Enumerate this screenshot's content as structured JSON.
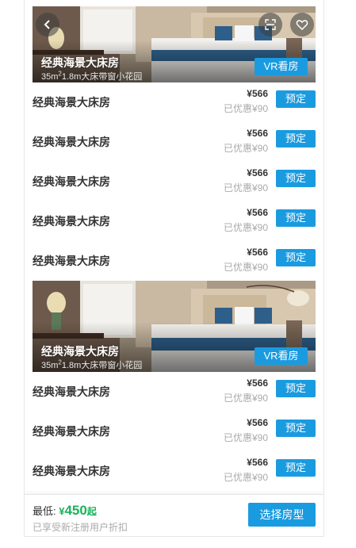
{
  "rooms": [
    {
      "title": "经典海景大床房",
      "size": "35m",
      "size_sup": "2",
      "desc": "1.8m大床带窗小花园",
      "vr_label": "VR看房",
      "options": [
        {
          "name": "经典海景大床房",
          "price": "¥566",
          "discount": "已优惠¥90",
          "book_label": "预定"
        },
        {
          "name": "经典海景大床房",
          "price": "¥566",
          "discount": "已优惠¥90",
          "book_label": "预定"
        },
        {
          "name": "经典海景大床房",
          "price": "¥566",
          "discount": "已优惠¥90",
          "book_label": "预定"
        },
        {
          "name": "经典海景大床房",
          "price": "¥566",
          "discount": "已优惠¥90",
          "book_label": "预定"
        },
        {
          "name": "经典海景大床房",
          "price": "¥566",
          "discount": "已优惠¥90",
          "book_label": "预定"
        }
      ]
    },
    {
      "title": "经典海景大床房",
      "size": "35m",
      "size_sup": "2",
      "desc": "1.8m大床带窗小花园",
      "vr_label": "VR看房",
      "options": [
        {
          "name": "经典海景大床房",
          "price": "¥566",
          "discount": "已优惠¥90",
          "book_label": "预定"
        },
        {
          "name": "经典海景大床房",
          "price": "¥566",
          "discount": "已优惠¥90",
          "book_label": "预定"
        },
        {
          "name": "经典海景大床房",
          "price": "¥566",
          "discount": "已优惠¥90",
          "book_label": "预定"
        }
      ]
    }
  ],
  "header_icons": {
    "back": "chevron-left-icon",
    "fullscreen": "fullscreen-icon",
    "favorite": "heart-icon"
  },
  "footer": {
    "min_label": "最低: ",
    "currency": "¥",
    "min_price": "450",
    "suffix": "起",
    "note": "已享受新注册用户折扣",
    "select_label": "选择房型"
  },
  "colors": {
    "accent": "#1a9be0",
    "price_green": "#1ab35b"
  }
}
